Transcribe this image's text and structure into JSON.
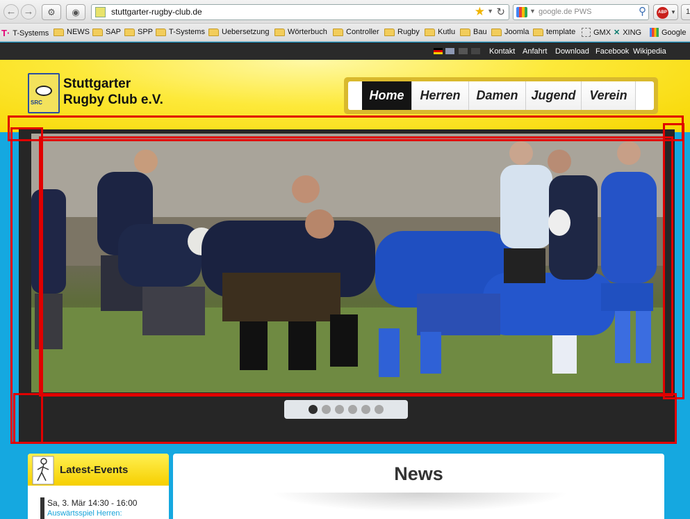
{
  "browser": {
    "url": "stuttgarter-rugby-club.de",
    "search_placeholder": "google.de PWS",
    "abp_label": "ABP",
    "last_button": "1",
    "bookmarks": [
      "T-Systems",
      "NEWS",
      "SAP",
      "SPP",
      "T-Systems",
      "Uebersetzung",
      "Wörterbuch",
      "Controller",
      "Rugby",
      "Kutlu",
      "Bau",
      "Joomla",
      "template",
      "GMX",
      "XING",
      "Google"
    ]
  },
  "topbar": {
    "links": [
      "Kontakt",
      "Anfahrt",
      "Download",
      "Facebook",
      "Wikipedia"
    ]
  },
  "header": {
    "club_line1": "Stuttgarter",
    "club_line2": "Rugby Club e.V.",
    "logo_text": "SRC",
    "nav": [
      "Home",
      "Herren",
      "Damen",
      "Jugend",
      "Verein"
    ],
    "active_nav": "Home"
  },
  "slider": {
    "slide_count": 6,
    "active_index": 0
  },
  "sidebar": {
    "title": "Latest-Events",
    "event_date": "Sa, 3. Mär 14:30 - 16:00",
    "event_title": "Auswärtsspiel Herren:"
  },
  "news": {
    "title": "News"
  },
  "colors": {
    "sky_blue": "#15a8e0",
    "header_yellow": "#fde93a",
    "annotation_red": "#e00000",
    "nav_active": "#141414"
  }
}
